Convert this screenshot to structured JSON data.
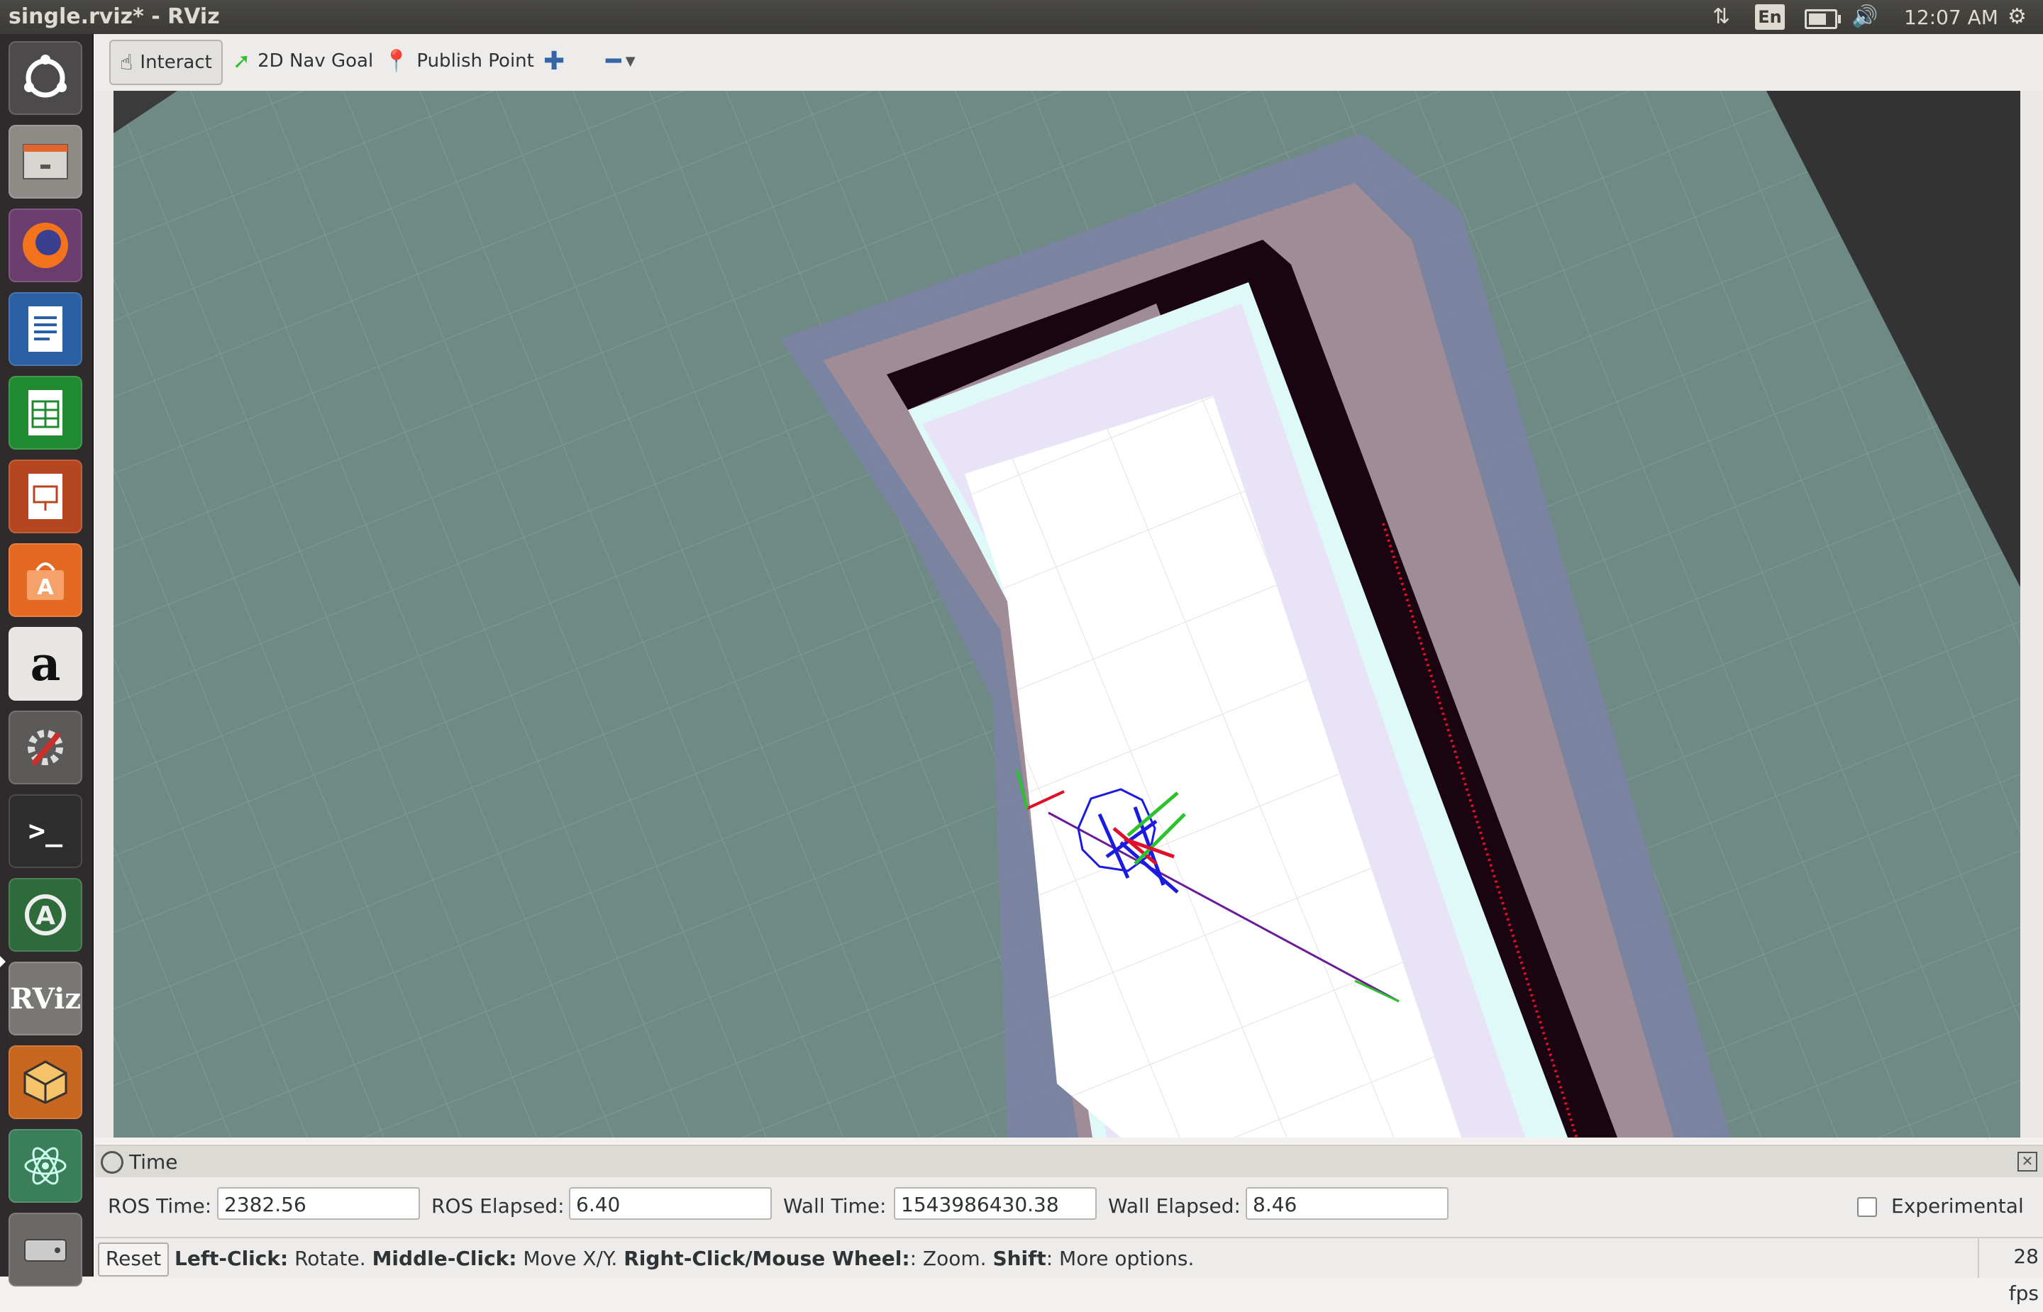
{
  "window": {
    "title": "single.rviz* - RViz"
  },
  "topbar": {
    "language": "En",
    "clock": "12:07 AM",
    "battery_level": 0.7
  },
  "launcher": {
    "items": [
      {
        "name": "ubuntu-dash-icon"
      },
      {
        "name": "files-icon"
      },
      {
        "name": "firefox-icon"
      },
      {
        "name": "writer-icon"
      },
      {
        "name": "calc-icon"
      },
      {
        "name": "impress-icon"
      },
      {
        "name": "software-center-icon"
      },
      {
        "name": "amazon-icon",
        "label": "a"
      },
      {
        "name": "system-settings-icon"
      },
      {
        "name": "terminal-icon",
        "label": ">_"
      },
      {
        "name": "software-updater-icon",
        "label": "A"
      },
      {
        "name": "rviz-icon",
        "label": "RViz"
      },
      {
        "name": "virtualbox-icon"
      },
      {
        "name": "atom-icon"
      },
      {
        "name": "drive-icon"
      }
    ]
  },
  "toolbar": {
    "interact": "Interact",
    "nav_goal": "2D Nav Goal",
    "publish_point": "Publish Point"
  },
  "time_panel": {
    "title": "Time",
    "ros_time_label": "ROS Time:",
    "ros_time": "2382.56",
    "ros_elapsed_label": "ROS Elapsed:",
    "ros_elapsed": "6.40",
    "wall_time_label": "Wall Time:",
    "wall_time": "1543986430.38",
    "wall_elapsed_label": "Wall Elapsed:",
    "wall_elapsed": "8.46",
    "experimental_label": "Experimental",
    "experimental_checked": false
  },
  "statusbar": {
    "reset": "Reset",
    "hint_left_click": "Left-Click:",
    "hint_rotate": " Rotate. ",
    "hint_middle_click": "Middle-Click:",
    "hint_move": " Move X/Y. ",
    "hint_right_click": "Right-Click/Mouse Wheel:",
    "hint_zoom": ": Zoom. ",
    "hint_shift": "Shift",
    "hint_more": ": More options.",
    "fps": "28 fps"
  },
  "colors": {
    "background_grid": "#6f8a85",
    "map_free": "#ffffff",
    "map_wall": "#1a0410",
    "costmap_inflation": "#7c83a6",
    "laser": "#e0102a",
    "plan": "#6a1b9a"
  }
}
